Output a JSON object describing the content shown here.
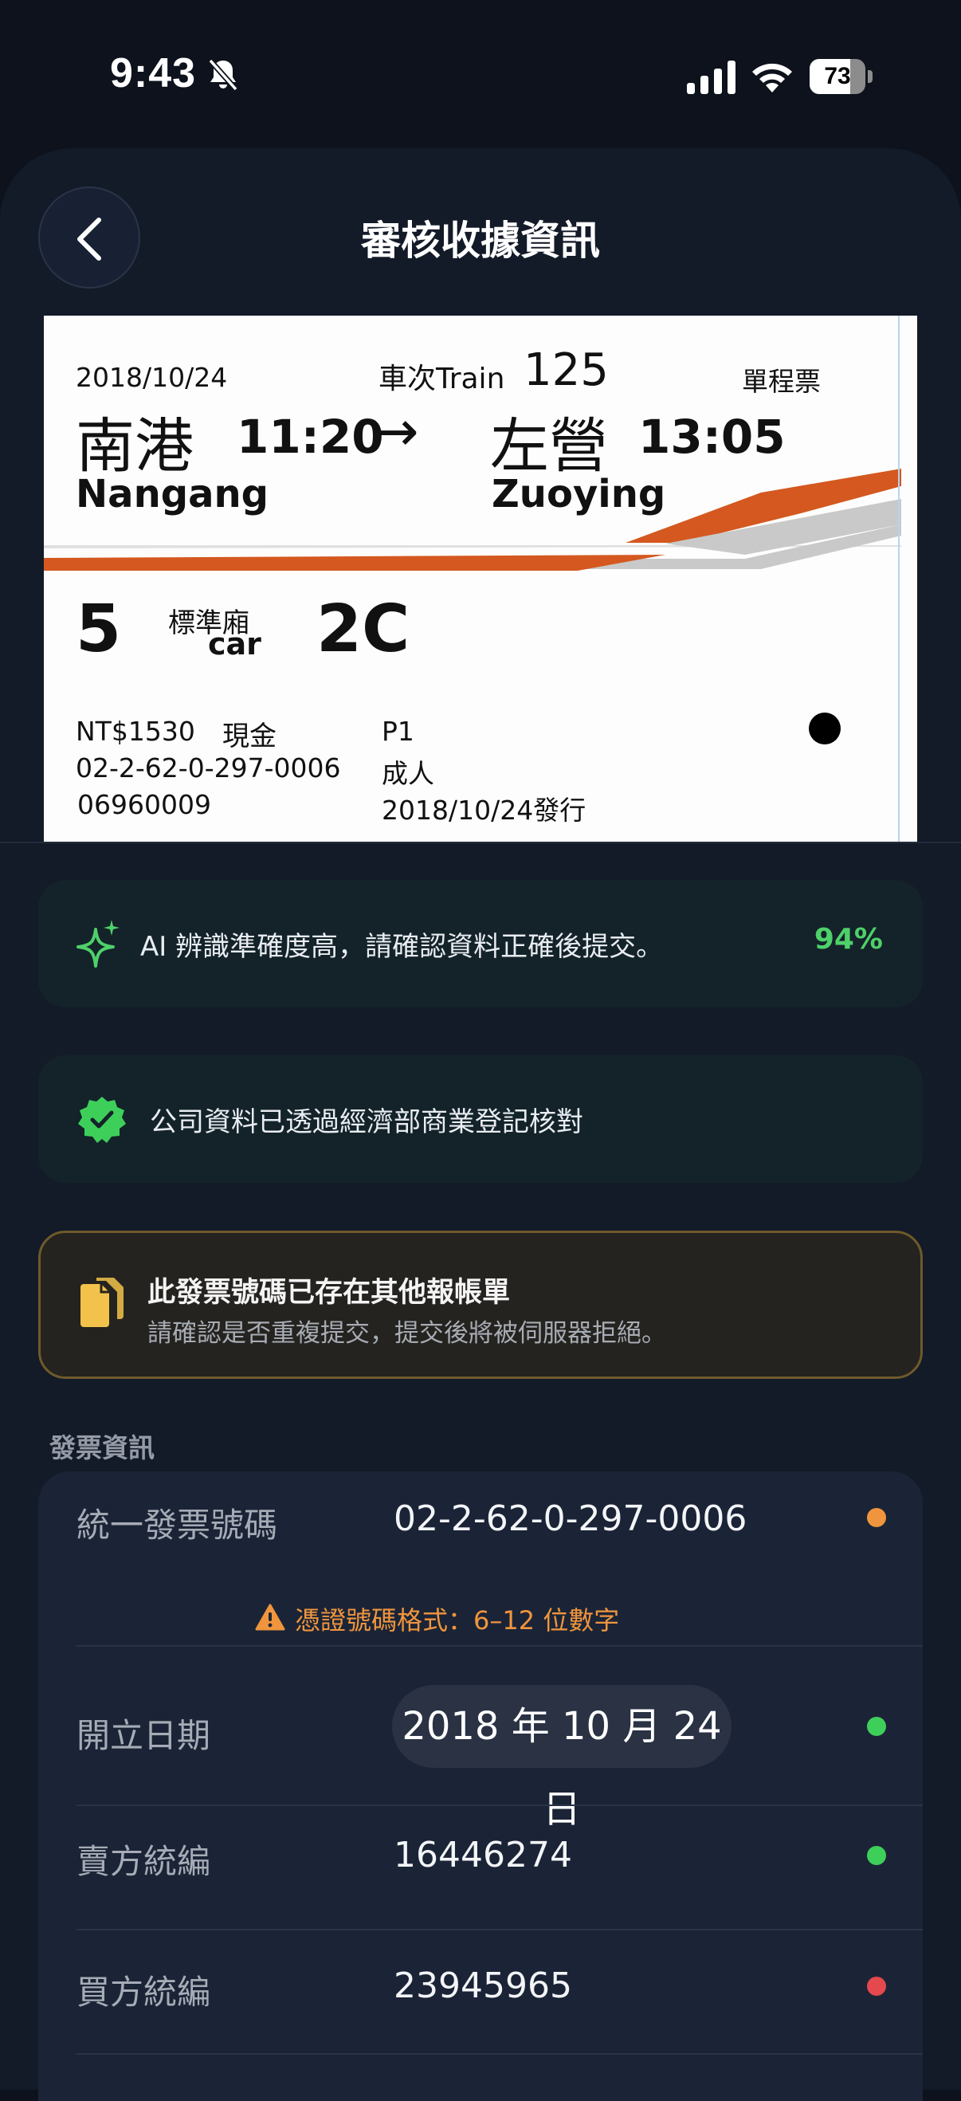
{
  "status_bar": {
    "time": "9:43",
    "battery": "73",
    "battery_level": 0.73
  },
  "header": {
    "title": "審核收據資訊"
  },
  "ticket": {
    "date": "2018/10/24",
    "train_label": "車次Train",
    "train_no": "125",
    "ticket_type": "單程票",
    "from_zh": "南港",
    "from_time": "11:20",
    "arrow": "→",
    "to_zh": "左營",
    "to_time": "13:05",
    "from_en": "Nangang",
    "to_en": "Zuoying",
    "car_no": "5",
    "car_class": "標準廂",
    "car_label": "car",
    "seat": "2C",
    "price": "NT$1530",
    "payment": "現金",
    "platform": "P1",
    "ticket_no": "02-2-62-0-297-0006",
    "passenger": "成人",
    "serial": "06960009",
    "issued": "2018/10/24發行",
    "colors": {
      "stripe_orange": "#d4581f",
      "stripe_gray": "#c8c8c8"
    }
  },
  "ai_banner": {
    "text": "AI 辨識準確度高，請確認資料正確後提交。",
    "confidence": "94%",
    "icon": "sparkle-icon"
  },
  "verified_banner": {
    "text": "公司資料已透過經濟部商業登記核對",
    "icon": "verified-badge-icon"
  },
  "duplicate_warning": {
    "title": "此發票號碼已存在其他報帳單",
    "message": "請確認是否重複提交，提交後將被伺服器拒絕。",
    "icon": "duplicate-document-icon"
  },
  "invoice_section": {
    "label": "發票資訊",
    "rows": [
      {
        "label": "統一發票號碼",
        "value": "02-2-62-0-297-0006",
        "status": "warning",
        "status_color": "#f0953d"
      },
      {
        "label": "開立日期",
        "value": "2018 年 10 月 24 日",
        "status": "ok",
        "status_color": "#3ecf5b"
      },
      {
        "label": "賣方統編",
        "value": "16446274",
        "status": "ok",
        "status_color": "#3ecf5b"
      },
      {
        "label": "買方統編",
        "value": "23945965",
        "status": "error",
        "status_color": "#e5484d"
      }
    ],
    "format_error": "憑證號碼格式：6–12 位數字"
  },
  "colors": {
    "background": "#0d121c",
    "sheet": "#131a28",
    "success": "#4fd06a",
    "warning": "#f0953d",
    "error": "#e5484d"
  }
}
